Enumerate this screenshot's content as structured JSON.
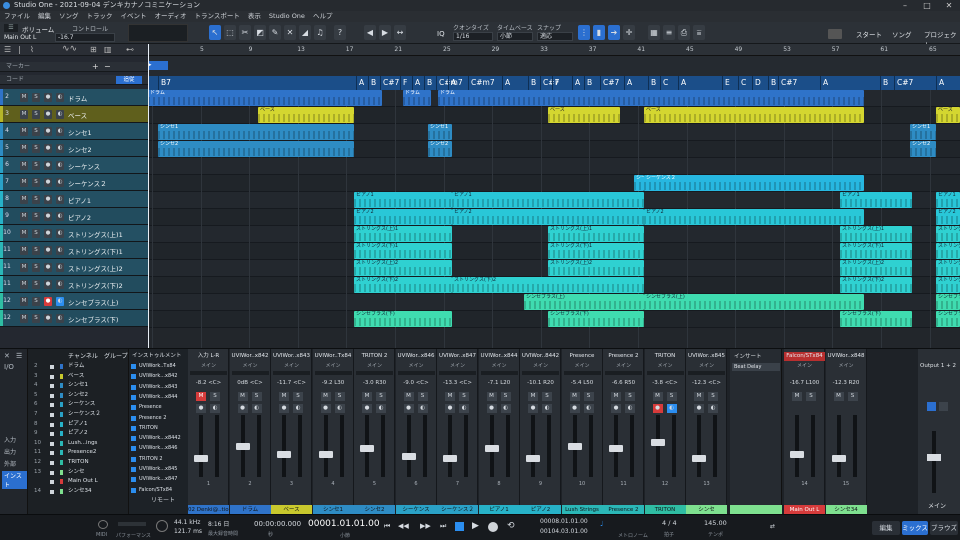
{
  "titlebar": {
    "title": "Studio One - 2021-09-04 デンキカナノコミニケーション"
  },
  "menu": [
    "ファイル",
    "編集",
    "ソング",
    "トラック",
    "イベント",
    "オーディオ",
    "トランスポート",
    "表示",
    "Studio One",
    "ヘルプ"
  ],
  "toolbar": {
    "volume_label": "ボリューム",
    "output_label": "Main Out L",
    "control_label": "コントロール",
    "volume_value": "-16.7",
    "quantize_label": "クオンタイズ",
    "quantize_value": "1/16",
    "timebase_label": "タイムベース",
    "timebase_value": "小節",
    "snap_label": "スナップ",
    "snap_value": "適応",
    "iq_label": "IQ",
    "start_label": "スタート",
    "song_label": "ソング",
    "project_label": "プロジェクト"
  },
  "tracklist": {
    "marker_label": "マーカー",
    "chord_label": "コード",
    "follow_label": "追従",
    "tracks": [
      {
        "num": "2",
        "name": "ドラム",
        "color": "#2f73c9"
      },
      {
        "num": "3",
        "name": "ベース",
        "color": "#b6b629"
      },
      {
        "num": "4",
        "name": "シンセ1",
        "color": "#2e8cc4"
      },
      {
        "num": "5",
        "name": "シンセ2",
        "color": "#2e8cc4"
      },
      {
        "num": "6",
        "name": "シーケンス",
        "color": "#2aa1c6"
      },
      {
        "num": "7",
        "name": "シーケンス２",
        "color": "#2aa1c6"
      },
      {
        "num": "8",
        "name": "ピアノ1",
        "color": "#27b2c8"
      },
      {
        "num": "9",
        "name": "ピアノ2",
        "color": "#27b2c8"
      },
      {
        "num": "10",
        "name": "ストリングス(上)1",
        "color": "#2bb7b7"
      },
      {
        "num": "11",
        "name": "ストリングス(下)1",
        "color": "#2bb7b7"
      },
      {
        "num": "11",
        "name": "ストリングス(上)2",
        "color": "#2bb7b7"
      },
      {
        "num": "11",
        "name": "ストリングス(下)2",
        "color": "#2bb7b7"
      },
      {
        "num": "12",
        "name": "シンセブラス(上)",
        "color": "#2fbda3"
      },
      {
        "num": "12",
        "name": "シンセブラス(下)",
        "color": "#2fbda3"
      }
    ]
  },
  "ruler": [
    "5",
    "9",
    "13",
    "17",
    "21",
    "25",
    "29",
    "33",
    "37",
    "41",
    "45",
    "49",
    "53",
    "57",
    "61",
    "65"
  ],
  "chords": [
    "B7",
    "A",
    "B",
    "C#7",
    "F",
    "A",
    "B",
    "C#m7",
    "A",
    "C#m7",
    "A",
    "B",
    "C#7",
    "F",
    "A",
    "B",
    "C#7",
    "A",
    "B",
    "C",
    "A",
    "E",
    "C",
    "D",
    "B",
    "C#7",
    "A",
    "B",
    "C#7",
    "A"
  ],
  "clip_labels": {
    "drums": "ドラム",
    "bass": "ベース",
    "synth1": "シンセ1",
    "synth2": "シンセ2",
    "seq2": "シーケンス２",
    "piano1": "ピアノ1",
    "piano2": "ピアノ2",
    "str_up1": "ストリングス(上)1",
    "str_dn1": "ストリングス(下)1",
    "str_up2": "ストリングス(上)2",
    "str_dn2": "ストリングス(下)2",
    "brass_up": "シンセブラス(上)",
    "brass_dn": "シンセブラス(下)"
  },
  "mixer_list": {
    "header_channel": "チャンネル",
    "header_group": "グループ",
    "header_inst": "インストゥルメント",
    "rows": [
      {
        "num": "2",
        "name": "ドラム"
      },
      {
        "num": "3",
        "name": "ベース"
      },
      {
        "num": "4",
        "name": "シンセ1"
      },
      {
        "num": "5",
        "name": "シンセ2"
      },
      {
        "num": "6",
        "name": "シーケンス"
      },
      {
        "num": "7",
        "name": "シーケンス２"
      },
      {
        "num": "8",
        "name": "ピアノ1"
      },
      {
        "num": "9",
        "name": "ピアノ2"
      },
      {
        "num": "10",
        "name": "Lush...ings"
      },
      {
        "num": "11",
        "name": "Presence2"
      },
      {
        "num": "12",
        "name": "TRITON"
      },
      {
        "num": "13",
        "name": "シンセ"
      },
      {
        "num": "",
        "name": "Main Out L"
      },
      {
        "num": "14",
        "name": "シンセ34"
      }
    ],
    "inst_rows": [
      "UVIWork..Tx84",
      "UVIWork...x842",
      "UVIWork...x843",
      "UVIWork...x844",
      "Presence",
      "Presence 2",
      "TRITON",
      "UVIWork...x8442",
      "UVIWork...x846",
      "TRITON 2",
      "UVIWork...x845",
      "UVIWork...x847",
      "Falcon/STx84"
    ],
    "side": [
      "入力",
      "出力",
      "外部"
    ],
    "inst_label": "インスト",
    "remote_label": "リモート"
  },
  "channels": [
    {
      "hd": "入力 L-R",
      "vals": "-8.2  <C>",
      "foot": "02 Denki@..tion",
      "fc": "#2f73c9",
      "num": "1"
    },
    {
      "hd": "UVIWor..x842",
      "vals": "0dB  <C>",
      "foot": "ドラム",
      "fc": "#2f73c9",
      "num": "2"
    },
    {
      "hd": "UVIWor..x843",
      "vals": "-11.7  <C>",
      "foot": "ベース",
      "fc": "#c8c82d",
      "num": "3"
    },
    {
      "hd": "UVIWor..Tx84",
      "vals": "-9.2  L30",
      "foot": "シンセ1",
      "fc": "#2e8cc4",
      "num": "4"
    },
    {
      "hd": "TRITON 2",
      "vals": "-3.0  R30",
      "foot": "シンセ2",
      "fc": "#2e8cc4",
      "num": "5"
    },
    {
      "hd": "UVIWor..x846",
      "vals": "-9.0  <C>",
      "foot": "シーケンス",
      "fc": "#2aa1c6",
      "num": "6"
    },
    {
      "hd": "UVIWor..x847",
      "vals": "-13.3  <C>",
      "foot": "シーケンス２",
      "fc": "#2aa1c6",
      "num": "7"
    },
    {
      "hd": "UVIWor..x844",
      "vals": "-7.1  L20",
      "foot": "ピアノ1",
      "fc": "#27b2c8",
      "num": "8"
    },
    {
      "hd": "UVIWor..8442",
      "vals": "-10.1  R20",
      "foot": "ピアノ2",
      "fc": "#27b2c8",
      "num": "9"
    },
    {
      "hd": "Presence",
      "vals": "-5.4  L50",
      "foot": "Lush Strings",
      "fc": "#2bb7b7",
      "num": "10"
    },
    {
      "hd": "Presence 2",
      "vals": "-6.6  R50",
      "foot": "Presence 2",
      "fc": "#2bb7b7",
      "num": "11"
    },
    {
      "hd": "TRITON",
      "vals": "-3.8  <C>",
      "foot": "TRITON",
      "fc": "#2fbda3",
      "num": "12"
    },
    {
      "hd": "UVIWor..x845",
      "vals": "-12.3  <C>",
      "foot": "シンセ",
      "fc": "#7ee08f",
      "num": "13"
    },
    {
      "hd": "Falcon/STx84",
      "vals": "-16.7  L100",
      "foot": "Main Out L",
      "fc": "#d63b3b",
      "num": "14"
    },
    {
      "hd": "UVIWor..x848",
      "vals": "-12.3  R20",
      "foot": "シンセ34",
      "fc": "#7ee08f",
      "num": "15"
    }
  ],
  "inserts": {
    "title": "インサート",
    "item": "Beat Delay"
  },
  "master": {
    "title": "Output 1 + 2",
    "label": "メイン"
  },
  "mix_common": {
    "main": "メイン",
    "m": "M",
    "s": "S"
  },
  "transport": {
    "midi": "MIDI",
    "performance": "パフォーマンス",
    "samplerate": "44.1 kHz",
    "latency": "121.7 ms",
    "time": "8:16 日",
    "rec_time": "最大録音時間",
    "seconds": "00:00:00.000",
    "seconds_label": "秒",
    "bars": "00001.01.01.00",
    "bars_label": "小節",
    "loop_start": "00008.01.01.00",
    "loop_end": "00104.03.01.00",
    "metronome": "メトロノーム",
    "timesig": "4 / 4",
    "timesig_label": "拍子",
    "tempo": "145.00",
    "tempo_label": "テンポ",
    "edit": "編集",
    "mix": "ミックス",
    "browse": "ブラウズ"
  }
}
